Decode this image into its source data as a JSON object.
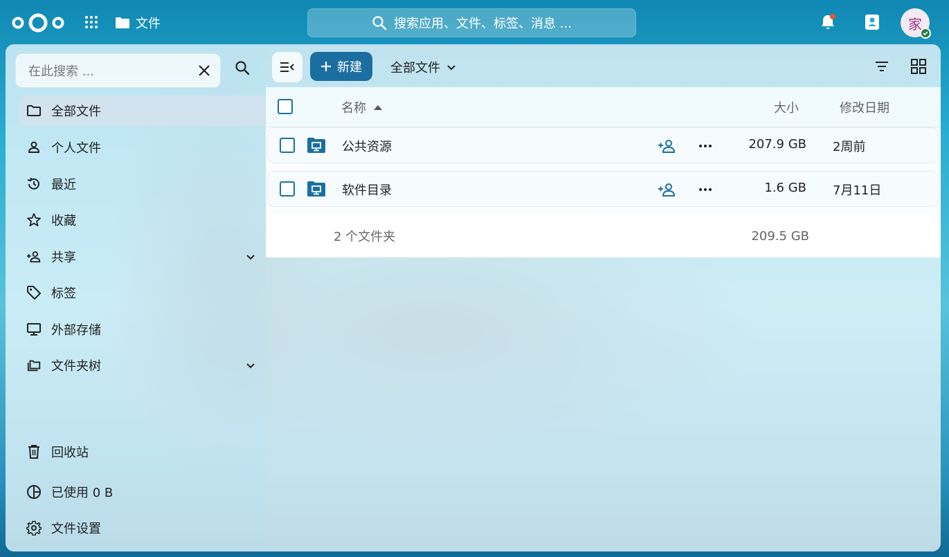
{
  "header": {
    "app_title": "文件",
    "search_placeholder": "搜索应用、文件、标签、消息 ...",
    "avatar_initial": "家"
  },
  "sidebar": {
    "search_placeholder": "在此搜索 ...",
    "items": [
      {
        "label": "全部文件",
        "icon": "folder-icon",
        "active": true
      },
      {
        "label": "个人文件",
        "icon": "person-icon"
      },
      {
        "label": "最近",
        "icon": "history-icon"
      },
      {
        "label": "收藏",
        "icon": "star-icon"
      },
      {
        "label": "共享",
        "icon": "share-icon",
        "expandable": true
      },
      {
        "label": "标签",
        "icon": "tag-icon"
      },
      {
        "label": "外部存储",
        "icon": "monitor-icon"
      },
      {
        "label": "文件夹树",
        "icon": "folder-tree-icon",
        "expandable": true
      }
    ],
    "footer": [
      {
        "label": "回收站",
        "icon": "trash-icon"
      },
      {
        "label": "已使用 0 B",
        "icon": "pie-chart-icon"
      },
      {
        "label": "文件设置",
        "icon": "gear-icon"
      }
    ]
  },
  "toolbar": {
    "new_label": "新建",
    "breadcrumb": "全部文件"
  },
  "table": {
    "columns": {
      "name": "名称",
      "size": "大小",
      "modified": "修改日期"
    },
    "rows": [
      {
        "name": "公共资源",
        "size": "207.9 GB",
        "modified": "2周前"
      },
      {
        "name": "软件目录",
        "size": "1.6 GB",
        "modified": "7月11日"
      }
    ],
    "summary": {
      "count": "2 个文件夹",
      "total": "209.5 GB"
    }
  },
  "colors": {
    "primary": "#1b6fa0",
    "notification_dot": "#e9532b",
    "status_online": "#2d7b41"
  }
}
